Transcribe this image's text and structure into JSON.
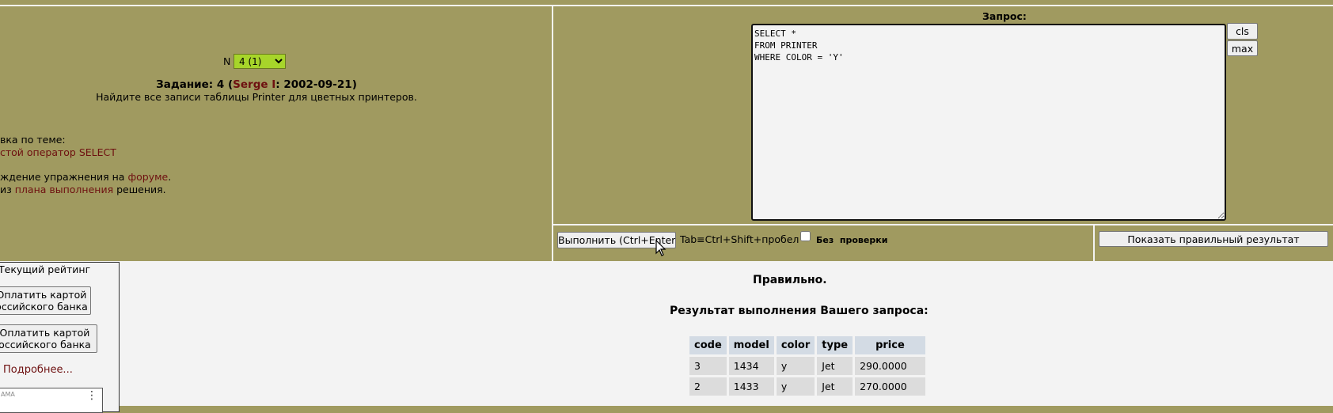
{
  "task": {
    "n_label": "N",
    "n_selected": "4 (1)",
    "title_prefix": "Задание: 4 (",
    "author": "Serge I",
    "title_suffix": ": 2002-09-21)",
    "description": "Найдите все записи таблицы Printer для цветных принтеров.",
    "help_line": "вка по теме:",
    "help_link": "стой оператор SELECT",
    "discussion_prefix": "ждение упражнения на ",
    "discussion_link": "форуме",
    "discussion_suffix": ".",
    "plan_prefix": "из ",
    "plan_link": "плана выполнения",
    "plan_suffix": " решения."
  },
  "query": {
    "label": "Запрос:",
    "text": "SELECT *\nFROM PRINTER\nWHERE COLOR = 'Y'",
    "cls_label": "cls",
    "max_label": "max"
  },
  "toolbar": {
    "run_label": "Выполнить (Ctrl+Enter)",
    "shortcut_hint": "Tab≡Ctrl+Shift+пробел",
    "nocheck_label": "Без  проверки",
    "nocheck_checked": false,
    "show_result_label": "Показать правильный результат"
  },
  "result": {
    "status": "Правильно.",
    "heading": "Результат выполнения Вашего запроса:",
    "columns": [
      "code",
      "model",
      "color",
      "type",
      "price"
    ],
    "rows": [
      [
        "3",
        "1434",
        "y",
        "Jet",
        "290.0000"
      ],
      [
        "2",
        "1433",
        "y",
        "Jet",
        "270.0000"
      ]
    ]
  },
  "sidebar": {
    "rating_label": "Текущий рейтинг",
    "pay_button_1_line1": "Оплатить картой",
    "pay_button_1_line2": "оссийского банка",
    "pay_button_2_line1": "Оплатить картой",
    "pay_button_2_line2": "оссийского банка",
    "more_link": "Подробнее...",
    "ad_label": "АМА"
  }
}
